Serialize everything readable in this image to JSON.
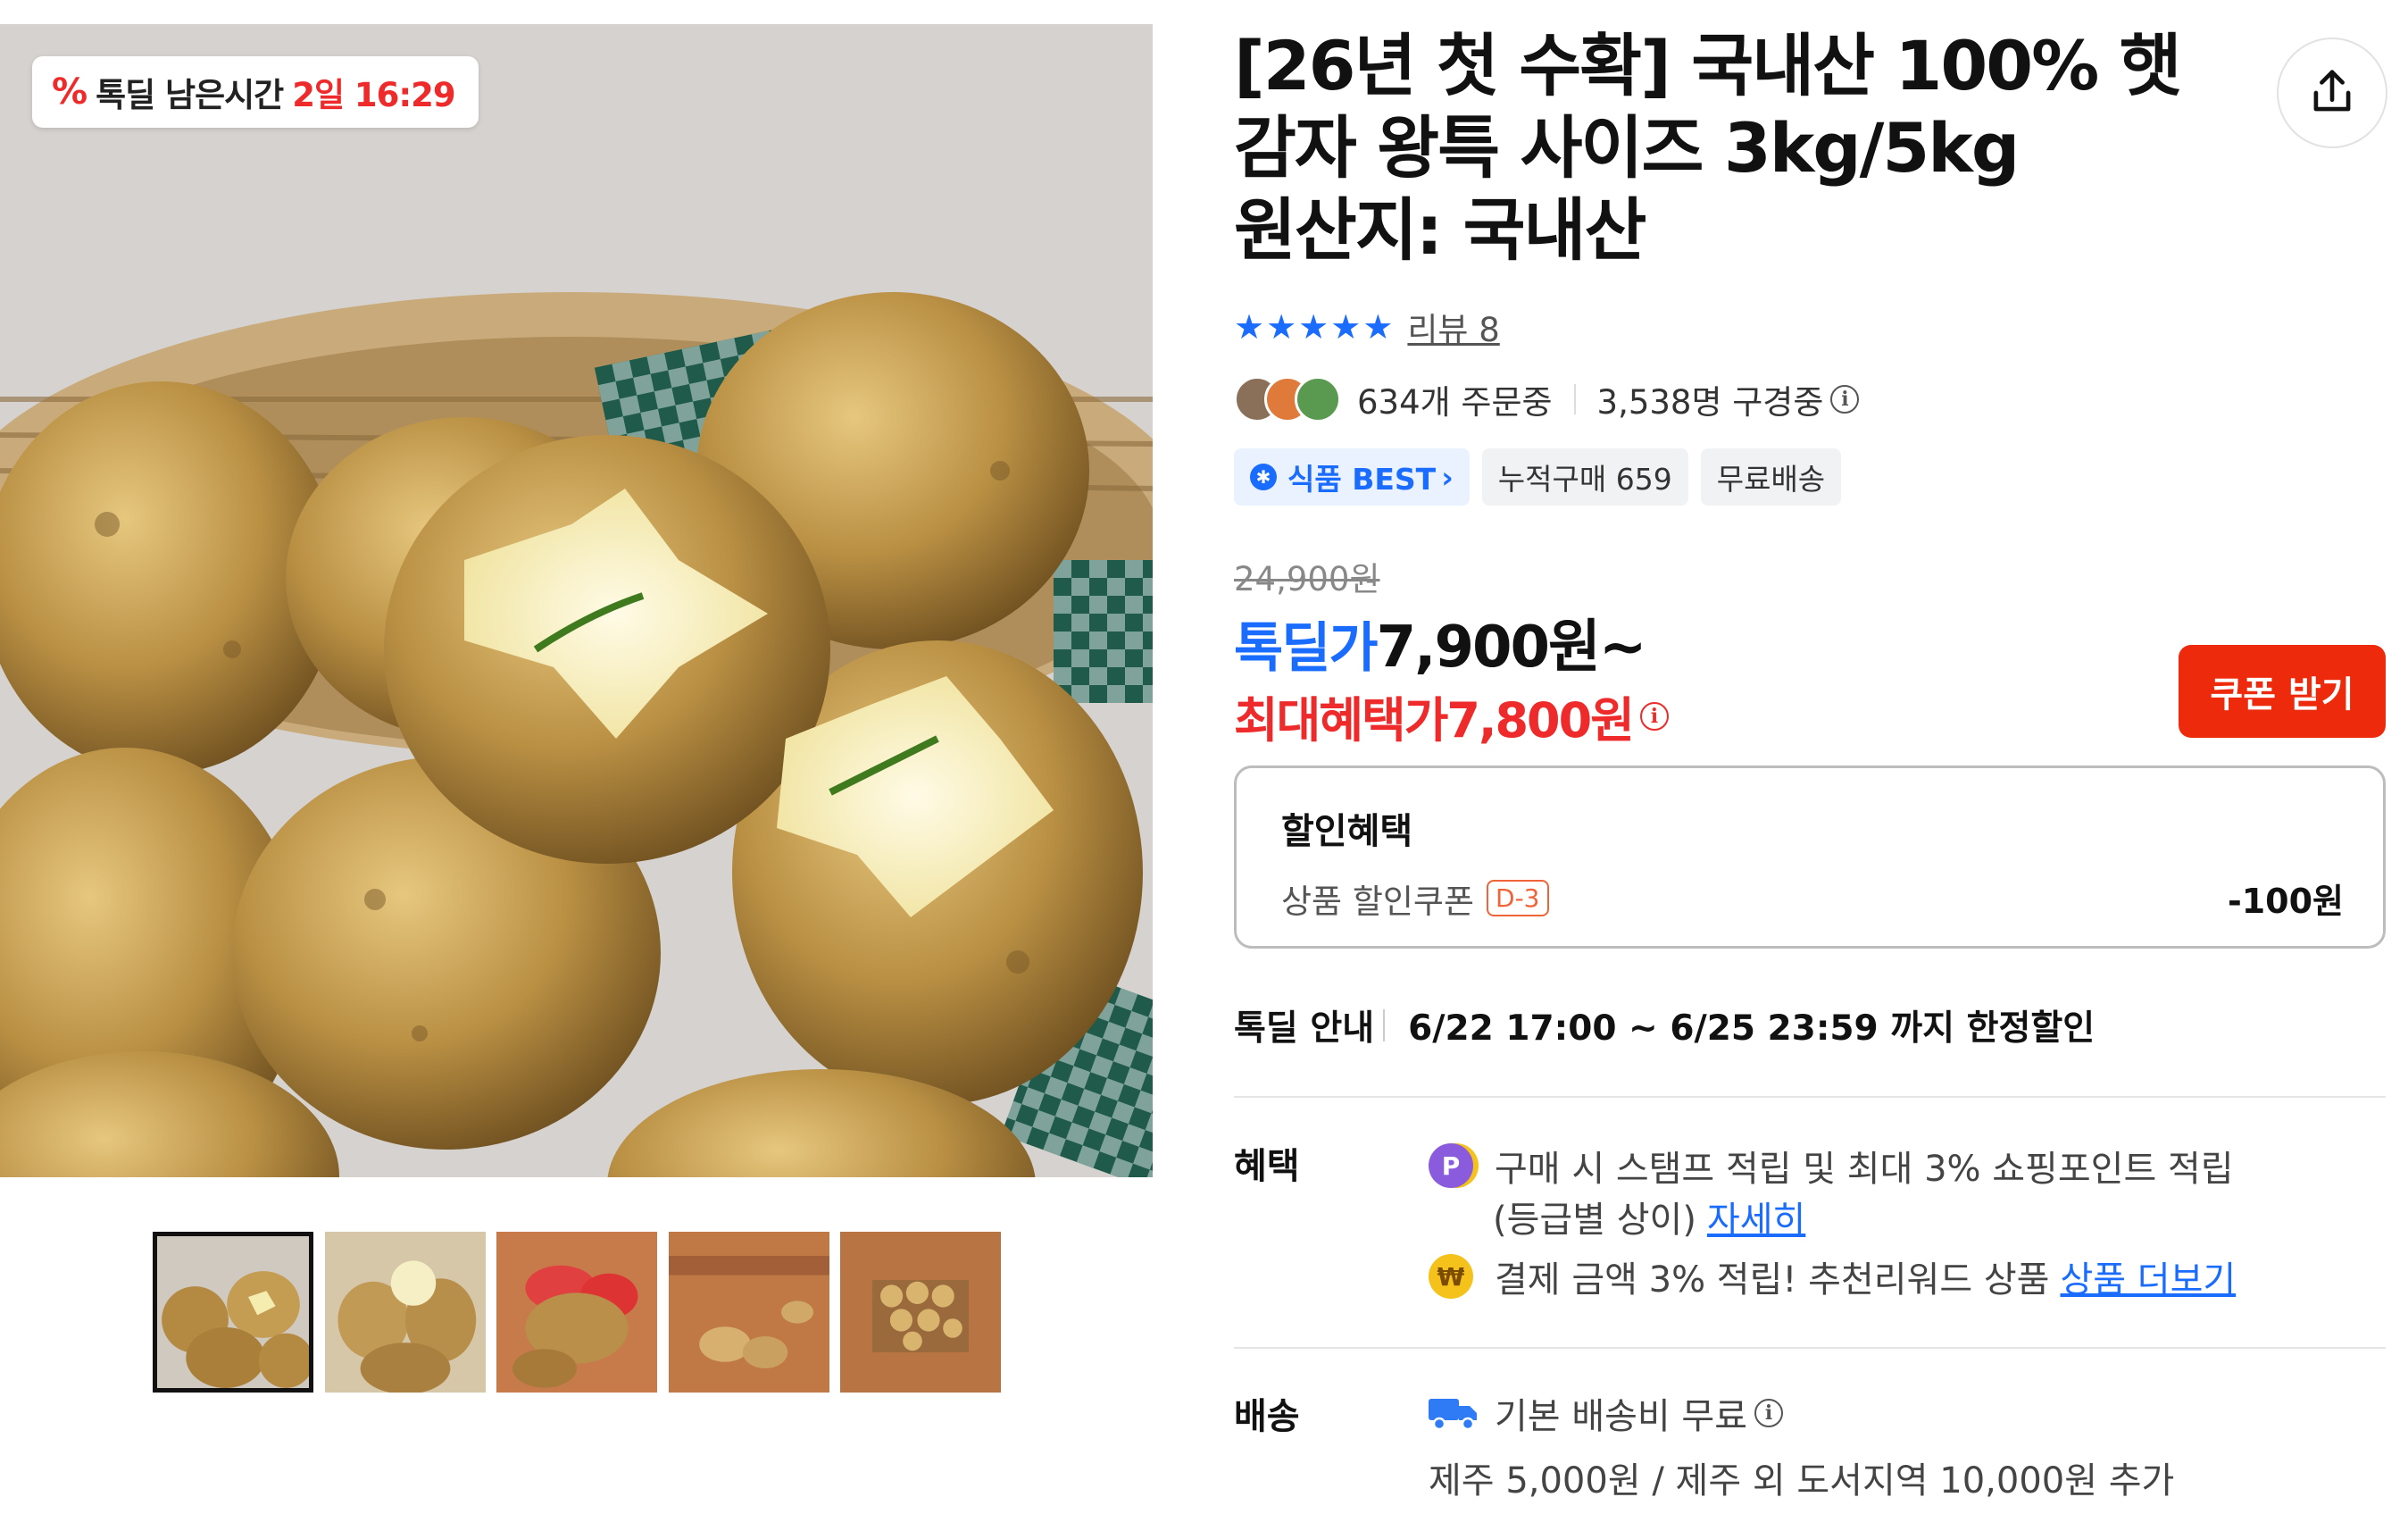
{
  "timer_badge": {
    "label": "톡딜 남은시간",
    "remaining": "2일 16:29"
  },
  "product": {
    "title_lines": [
      "[26년 첫 수확] 국내산 100% 햇",
      "감자 왕특 사이즈 3kg/5kg",
      "원산지: 국내산"
    ],
    "rating_stars": 5,
    "review_label": "리뷰 8"
  },
  "stats": {
    "orders": "634개 주문중",
    "viewers": "3,538명 구경중"
  },
  "tags": [
    "식품 BEST",
    "누적구매 659",
    "무료배송"
  ],
  "price": {
    "original": "24,900원",
    "deal_label": "톡딜가",
    "deal_value": "7,900원~",
    "max_benefit": "최대혜택가7,800원"
  },
  "coupon_button": "쿠폰 받기",
  "discount": {
    "title": "할인혜택",
    "item_label": "상품 할인쿠폰",
    "item_badge": "D-3",
    "item_amount": "-100원"
  },
  "deal_period": {
    "label": "톡딜 안내",
    "value": "6/22 17:00 ~ 6/25 23:59 까지 한정할인"
  },
  "benefits": {
    "label": "혜택",
    "line1": "구매 시 스탬프 적립 및 최대 3% 쇼핑포인트 적립",
    "line2": "(등급별 상이)",
    "line2_link": "자세히",
    "line3": "결제 금액 3% 적립! 추천리워드 상품",
    "line3_link": "상품 더보기"
  },
  "shipping": {
    "label": "배송",
    "line1": "기본 배송비 무료",
    "line2": "제주 5,000원 / 제주 외 도서지역 10,000원 추가"
  },
  "icons": {
    "share": "share-icon",
    "info": "info-icon",
    "truck": "truck-icon",
    "point_coin": "point-coin-icon",
    "reward_coin": "reward-coin-icon",
    "star": "star-icon",
    "best_badge": "best-badge-icon"
  },
  "colors": {
    "accent_blue": "#1a6cff",
    "deal_red": "#ee2a2a",
    "coupon_red": "#ee2a0c"
  }
}
